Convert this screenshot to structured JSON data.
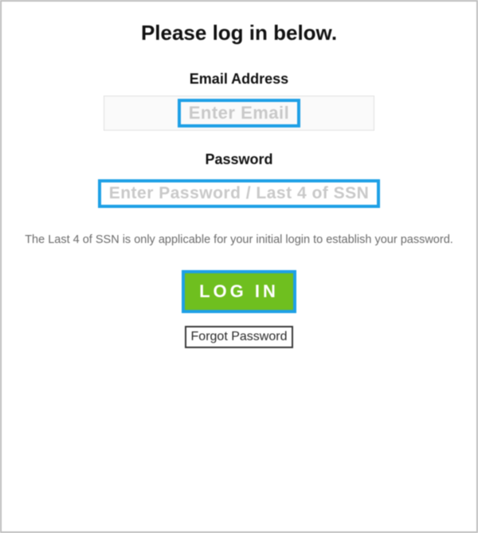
{
  "title": "Please log in below.",
  "email": {
    "label": "Email Address",
    "placeholder": "Enter Email"
  },
  "password": {
    "label": "Password",
    "placeholder": "Enter Password / Last 4 of SSN"
  },
  "help_text": "The Last 4 of SSN is only applicable for your initial login to establish your password.",
  "buttons": {
    "login": "LOG IN",
    "forgot": "Forgot Password"
  }
}
